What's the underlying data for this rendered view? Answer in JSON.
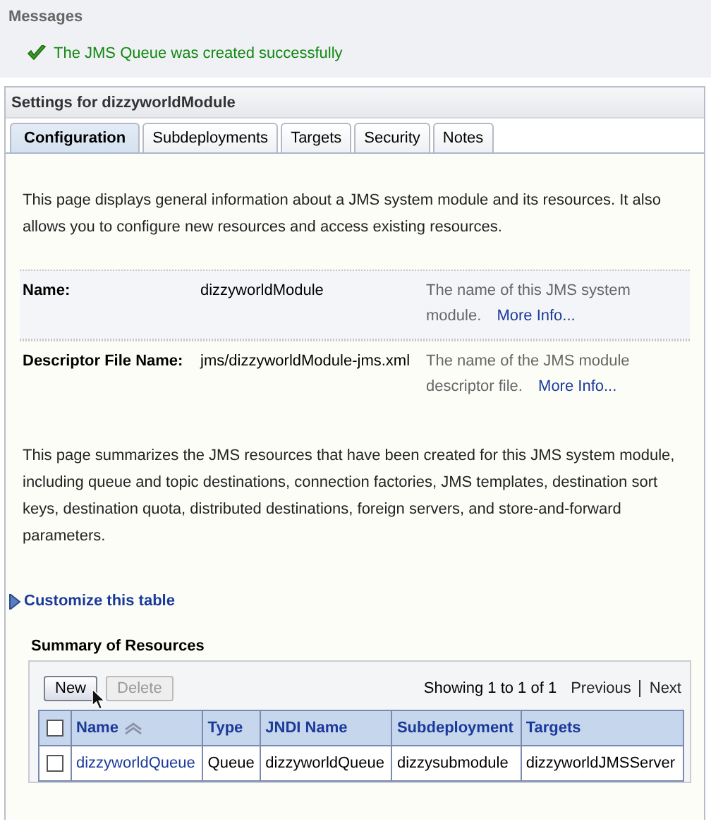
{
  "messages": {
    "title": "Messages",
    "items": [
      {
        "kind": "success",
        "text": "The JMS Queue was created successfully"
      }
    ]
  },
  "panel": {
    "title": "Settings for dizzyworldModule"
  },
  "tabs": [
    {
      "label": "Configuration",
      "selected": true
    },
    {
      "label": "Subdeployments",
      "selected": false
    },
    {
      "label": "Targets",
      "selected": false
    },
    {
      "label": "Security",
      "selected": false
    },
    {
      "label": "Notes",
      "selected": false
    }
  ],
  "intro": "This page displays general information about a JMS system module and its resources. It also allows you to configure new resources and access existing resources.",
  "fields": [
    {
      "label": "Name:",
      "value": "dizzyworldModule",
      "help": "The name of this JMS system module.",
      "link": "More Info..."
    },
    {
      "label": "Descriptor File Name:",
      "value": "jms/dizzyworldModule-jms.xml",
      "help": "The name of the JMS module descriptor file.",
      "link": "More Info..."
    }
  ],
  "summary_text": "This page summarizes the JMS resources that have been created for this JMS system module, including queue and topic destinations, connection factories, JMS templates, destination sort keys, destination quota, distributed destinations, foreign servers, and store-and-forward parameters.",
  "customize": {
    "label": "Customize this table",
    "expanded": false
  },
  "table": {
    "title": "Summary of Resources",
    "buttons": [
      {
        "label": "New",
        "disabled": false
      },
      {
        "label": "Delete",
        "disabled": true
      }
    ],
    "paging": {
      "status": "Showing 1 to 1 of 1",
      "previous": "Previous",
      "next": "Next"
    },
    "select_all_checked": false,
    "columns": [
      {
        "label": "Name",
        "sorted": true
      },
      {
        "label": "Type",
        "sorted": false
      },
      {
        "label": "JNDI Name",
        "sorted": false
      },
      {
        "label": "Subdeployment",
        "sorted": false
      },
      {
        "label": "Targets",
        "sorted": false
      }
    ],
    "rows": [
      {
        "checked": false,
        "cells": [
          "dizzyworldQueue",
          "Queue",
          "dizzyworldQueue",
          "dizzysubmodule",
          "dizzyworldJMSServer"
        ]
      }
    ]
  }
}
